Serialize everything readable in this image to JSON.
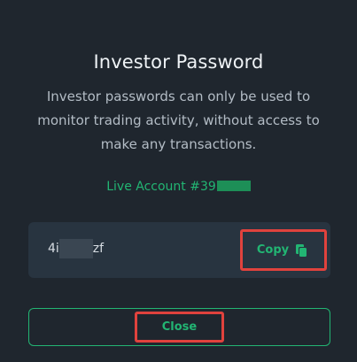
{
  "modal": {
    "title": "Investor Password",
    "description": "Investor passwords can only be used to monitor trading activity, without access to make any transactions.",
    "account_label": "Live Account #39",
    "password": {
      "prefix": "4i",
      "suffix": "zf"
    },
    "copy_label": "Copy",
    "close_label": "Close"
  },
  "colors": {
    "background": "#1f262e",
    "accent_green": "#22b573",
    "highlight_red": "#e0423d",
    "field_bg": "#283440"
  },
  "icons": {
    "copy": "copy-icon"
  }
}
